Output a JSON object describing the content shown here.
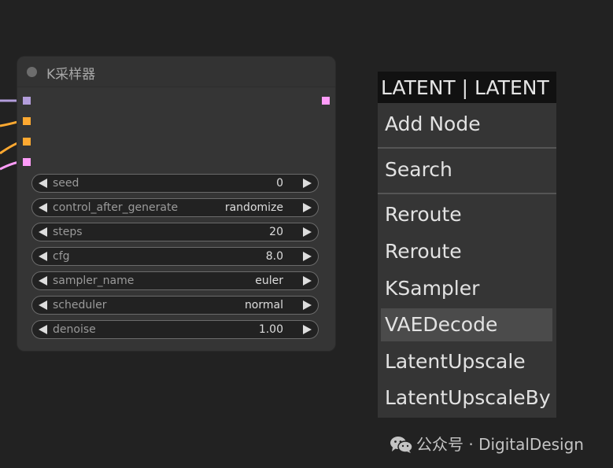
{
  "node": {
    "title": "K采样器",
    "colors": {
      "model_slot": "#b39ddb",
      "orange_slot": "#ffa931",
      "latent_slot": "#ff9cf9"
    },
    "widgets": [
      {
        "label": "seed",
        "value": "0"
      },
      {
        "label": "control_after_generate",
        "value": "randomize"
      },
      {
        "label": "steps",
        "value": "20"
      },
      {
        "label": "cfg",
        "value": "8.0"
      },
      {
        "label": "sampler_name",
        "value": "euler"
      },
      {
        "label": "scheduler",
        "value": "normal"
      },
      {
        "label": "denoise",
        "value": "1.00"
      }
    ]
  },
  "context_menu": {
    "title": "LATENT | LATENT",
    "items": [
      {
        "label": "Add Node"
      },
      {
        "label": "Search"
      },
      {
        "label": "Reroute"
      },
      {
        "label": "Reroute"
      },
      {
        "label": "KSampler"
      },
      {
        "label": "VAEDecode",
        "highlighted": true
      },
      {
        "label": "LatentUpscale"
      },
      {
        "label": "LatentUpscaleBy"
      }
    ]
  },
  "watermark": {
    "icon": "wechat-icon",
    "text": "公众号 · DigitalDesign"
  }
}
